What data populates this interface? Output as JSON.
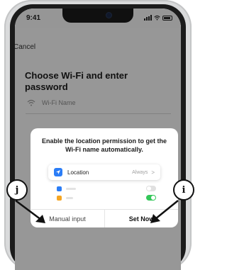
{
  "status_bar": {
    "time": "9:41"
  },
  "header": {
    "cancel_label": "Cancel"
  },
  "main": {
    "title": "Choose Wi-Fi and enter password",
    "wifi_name_placeholder": "Wi-Fi Name"
  },
  "dialog": {
    "message": "Enable the location permission to get the Wi-Fi name automatically.",
    "preview": {
      "location_label": "Location",
      "location_value": "Always",
      "chevron": ">"
    },
    "manual_input_label": "Manual input",
    "set_now_label": "Set Now"
  },
  "annotations": {
    "left_marker": "j",
    "right_marker": "i"
  },
  "colors": {
    "accent_blue": "#2b7df6",
    "toggle_green": "#34c759"
  }
}
